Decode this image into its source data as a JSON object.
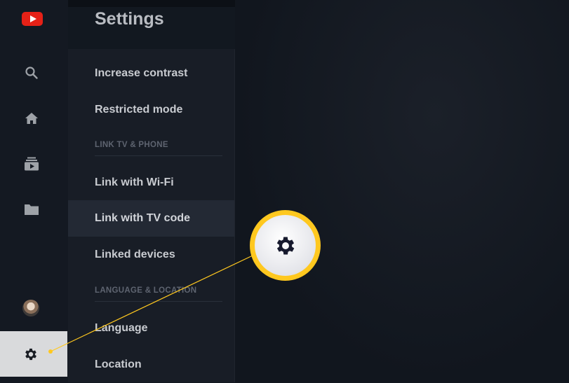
{
  "page": {
    "title": "Settings"
  },
  "nav": {
    "icons": [
      "youtube-logo",
      "search-icon",
      "home-icon",
      "subscriptions-icon",
      "library-folder-icon",
      "account-avatar",
      "gear-icon"
    ]
  },
  "menu": {
    "items": [
      {
        "label": "Increase contrast"
      },
      {
        "label": "Restricted mode"
      },
      {
        "label": "Link with Wi-Fi"
      },
      {
        "label": "Link with TV code"
      },
      {
        "label": "Linked devices"
      },
      {
        "label": "Language"
      },
      {
        "label": "Location"
      }
    ],
    "sections": [
      {
        "label": "LINK TV & PHONE"
      },
      {
        "label": "LANGUAGE & LOCATION"
      }
    ],
    "selected": "Link with TV code"
  },
  "colors": {
    "accent_callout": "#ffc81f",
    "youtube_red": "#e62117",
    "background": "#121820"
  }
}
